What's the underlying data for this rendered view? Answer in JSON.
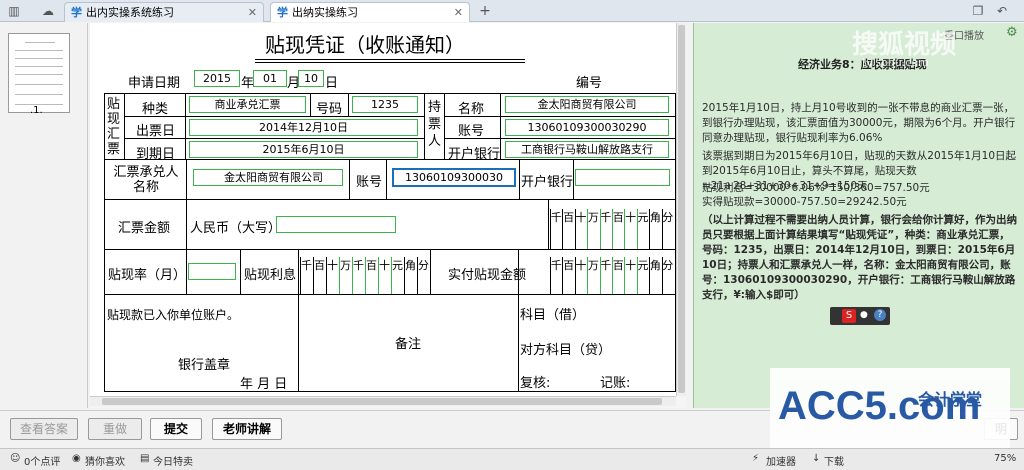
{
  "tabs": [
    {
      "label": "出内实操系统练习"
    },
    {
      "label": "出纳实操练习"
    }
  ],
  "voucher": {
    "title": "贴现凭证（收账通知）",
    "apply_date_label": "申请日期",
    "year": "2015",
    "year_unit": "年",
    "month": "01",
    "month_unit": "月",
    "day": "10",
    "day_unit": "日",
    "number_label": "编号",
    "side_label": "贴现汇票",
    "kind_label": "种类",
    "kind_value": "商业承兑汇票",
    "code_label": "号码",
    "code_value": "1235",
    "holder_label": "持票人",
    "name_label": "名称",
    "name_value": "金太阳商贸有限公司",
    "issue_date_label": "出票日",
    "issue_date_value": "2014年12月10日",
    "account_label": "账号",
    "account_value": "13060109300030290",
    "due_date_label": "到期日",
    "due_date_value": "2015年6月10日",
    "bank_label": "开户银行",
    "bank_value": "工商银行马鞍山解放路支行",
    "acceptor_label": "汇票承兑人名称",
    "acceptor_value": "金太阳商贸有限公司",
    "acceptor_account_label": "账号",
    "acceptor_account_value": "13060109300030",
    "acceptor_bank_label": "开户银行",
    "amount_label": "汇票金额",
    "rmb_label": "人民币（大写）",
    "digits": [
      "千",
      "百",
      "十",
      "万",
      "千",
      "百",
      "十",
      "元",
      "角",
      "分"
    ],
    "rate_label": "贴现率（月）",
    "interest_label": "贴现利息",
    "net_label": "实付贴现金额",
    "deposit_note": "贴现款已入你单位账户。",
    "bank_seal": "银行盖章",
    "seal_date": "年  月  日",
    "remark_label": "备注",
    "subject_debit": "科目（借）",
    "subject_credit": "对方科目（贷）",
    "review_label": "复核:",
    "bookkeeper_label": "记账:"
  },
  "panel": {
    "title": "经济业务8：应收票据贴现",
    "top_buttons": "重口播放",
    "p1": "2015年1月10日，持上月10号收到的一张不带息的商业汇票一张，到银行办理贴现，该汇票面值为30000元，期限为6个月。开户银行同意办理贴现，银行贴现利率为6.06%",
    "p2": "该票据到期日为2015年6月10日，贴现的天数从2015年1月10日起到2015年6月10日止，算头不算尾，贴现天数=21+28+31+30+31+9=150天",
    "p3": "贴现利息=30000*6.06%*150/360=757.50元",
    "p4": "实得贴现款=30000-757.50=29242.50元",
    "p5": "（以上计算过程不需要出纳人员计算，银行会给你计算好，作为出纳员只要根据上面计算结果填写“贴现凭证”，种类：商业承兑汇票，号码：1235，出票日：2014年12月10日，到票日：2015年6月10日；持票人和汇票承兑人一样，名称：金太阳商贸有限公司，账号：13060109300030290，开户银行：工商银行马鞍山解放路支行，¥:输入$即可）",
    "watermark": "搜狐视频",
    "watermark_url": "tv.sohu.com"
  },
  "buttons": {
    "view_answer": "查看答案",
    "redo": "重做",
    "submit": "提交",
    "teacher": "老师讲解",
    "explain_tail": "明"
  },
  "thumb_label": ".1.",
  "status": {
    "comments": "0个点评",
    "recommend": "猜你喜欢",
    "today": "今日特卖",
    "add_speed": "加速器",
    "download": "下载",
    "zoom": "75%"
  },
  "logo": {
    "text": "ACC5.com",
    "cn": "会计学堂"
  }
}
